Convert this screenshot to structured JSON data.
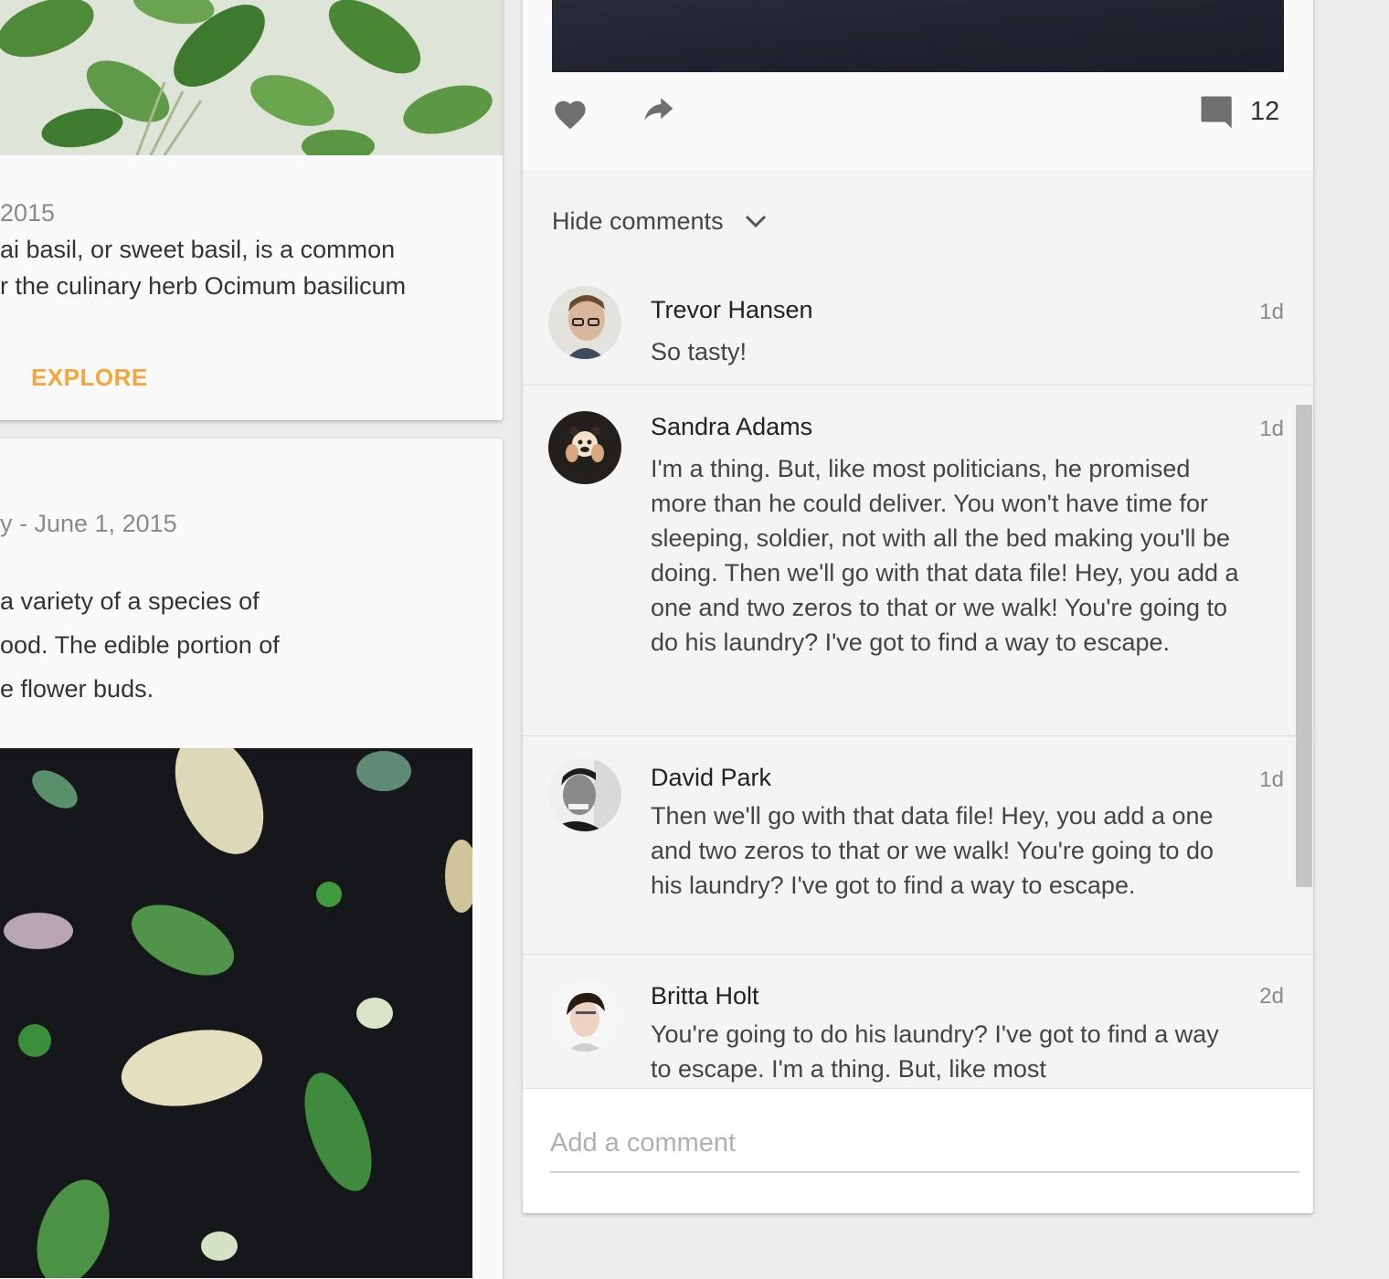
{
  "basil_card": {
    "date": "2015",
    "description_lines": [
      "ai basil, or sweet basil, is a common",
      "r the culinary herb Ocimum basilicum"
    ],
    "explore_label": "EXPLORE"
  },
  "artichoke_card": {
    "date": "y - June 1, 2015",
    "description_lines": [
      "a variety of a species of",
      "ood. The edible portion of",
      "e flower buds."
    ]
  },
  "post": {
    "comment_count": "12",
    "hide_comments_label": "Hide comments",
    "comments": [
      {
        "name": "Trevor Hansen",
        "time": "1d",
        "text": "So tasty!"
      },
      {
        "name": "Sandra Adams",
        "time": "1d",
        "text": "I'm a thing. But, like most politicians, he promised more than he could deliver. You won't have time for sleeping, soldier, not with all the bed making you'll be doing. Then we'll go with that data file! Hey, you add a one and two zeros to that or we walk! You're going to do his laundry? I've got to find a way to escape."
      },
      {
        "name": "David Park",
        "time": "1d",
        "text": "Then we'll go with that data file! Hey, you add a one and two zeros to that or we walk! You're going to do his laundry? I've got to find a way to escape."
      },
      {
        "name": "Britta Holt",
        "time": "2d",
        "text": "You're going to do his laundry? I've got to find a way to escape. I'm a thing. But, like most"
      }
    ],
    "add_comment_placeholder": "Add a comment"
  },
  "icons": {
    "like": "heart-icon",
    "share": "share-arrow-icon",
    "comments": "comment-bubble-icon",
    "hide_toggle": "chevron-down-icon"
  },
  "colors": {
    "accent": "#f7a53a",
    "card_background": "#fafafa",
    "page_background": "#ececec"
  }
}
